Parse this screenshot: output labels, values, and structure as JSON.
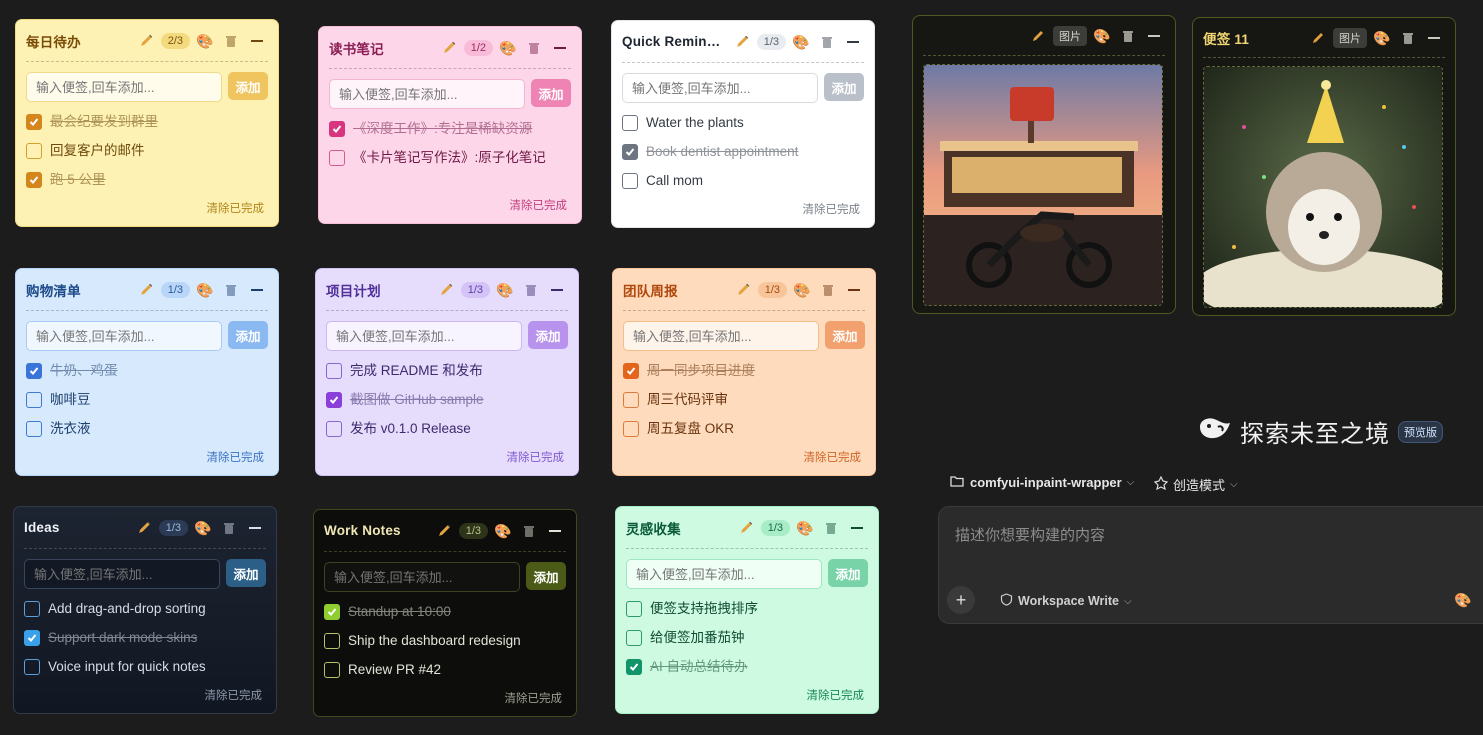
{
  "common": {
    "placeholder": "输入便签,回车添加...",
    "add_label": "添加",
    "clear_label": "清除已完成",
    "palette_icon": "🎨"
  },
  "notes": [
    {
      "title": "每日待办",
      "count": "2/3",
      "items": [
        {
          "text": "最会纪要发到群里",
          "done": true
        },
        {
          "text": "回复客户的邮件",
          "done": false
        },
        {
          "text": "跑 5 公里",
          "done": true
        }
      ]
    },
    {
      "title": "读书笔记",
      "count": "1/2",
      "items": [
        {
          "text": "《深度工作》:专注是稀缺资源",
          "done": true
        },
        {
          "text": "《卡片笔记写作法》:原子化笔记",
          "done": false
        }
      ]
    },
    {
      "title": "Quick Reminders",
      "count": "1/3",
      "items": [
        {
          "text": "Water the plants",
          "done": false
        },
        {
          "text": "Book dentist appointment",
          "done": true
        },
        {
          "text": "Call mom",
          "done": false
        }
      ]
    },
    {
      "title": "购物清单",
      "count": "1/3",
      "items": [
        {
          "text": "牛奶、鸡蛋",
          "done": true
        },
        {
          "text": "咖啡豆",
          "done": false
        },
        {
          "text": "洗衣液",
          "done": false
        }
      ]
    },
    {
      "title": "项目计划",
      "count": "1/3",
      "items": [
        {
          "text": "完成 README 和发布",
          "done": false
        },
        {
          "text": "截图做 GitHub sample",
          "done": true
        },
        {
          "text": "发布 v0.1.0 Release",
          "done": false
        }
      ]
    },
    {
      "title": "团队周报",
      "count": "1/3",
      "items": [
        {
          "text": "周一同步项目进度",
          "done": true
        },
        {
          "text": "周三代码评审",
          "done": false
        },
        {
          "text": "周五复盘 OKR",
          "done": false
        }
      ]
    },
    {
      "title": "Ideas",
      "count": "1/3",
      "items": [
        {
          "text": "Add drag-and-drop sorting",
          "done": false
        },
        {
          "text": "Support dark mode skins",
          "done": true
        },
        {
          "text": "Voice input for quick notes",
          "done": false
        }
      ]
    },
    {
      "title": "Work Notes",
      "count": "1/3",
      "items": [
        {
          "text": "Standup at 10:00",
          "done": true
        },
        {
          "text": "Ship the dashboard redesign",
          "done": false
        },
        {
          "text": "Review PR #42",
          "done": false
        }
      ]
    },
    {
      "title": "灵感收集",
      "count": "1/3",
      "items": [
        {
          "text": "便签支持拖拽排序",
          "done": false
        },
        {
          "text": "给便签加番茄钟",
          "done": false
        },
        {
          "text": "AI 自动总结待办",
          "done": true
        }
      ]
    }
  ],
  "image_notes": [
    {
      "title": "",
      "tag": "图片",
      "image": "diner-motorcycle-photo"
    },
    {
      "title": "便签 11",
      "tag": "图片",
      "image": "hedgehog-party-hat-photo"
    }
  ],
  "assistant": {
    "brand": "探索未至之境",
    "preview_badge": "预览版",
    "workspace": "comfyui-inpaint-wrapper",
    "mode": "创造模式",
    "prompt_placeholder": "描述你想要构建的内容",
    "permission": "Workspace Write"
  }
}
